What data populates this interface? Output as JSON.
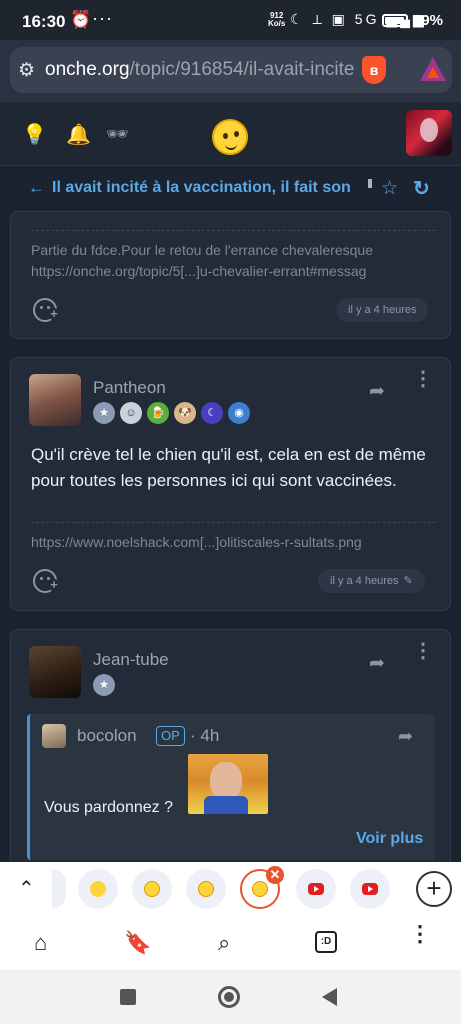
{
  "status_bar": {
    "time": "16:30",
    "alarm_icon": "⏰",
    "dots": "···",
    "net_speed_value": "912",
    "net_speed_unit": "Ko/s",
    "icons": "☾ ⟂ ▣ 5G ▂▄▆",
    "battery": "89%"
  },
  "browser": {
    "url_host": "onche.org",
    "url_path": "/topic/916854/il-avait-incite",
    "tune_icon": "⚙"
  },
  "site_header": {
    "bulb_icon": "💡",
    "bell_icon": "🔔",
    "spy_icon": "🕶"
  },
  "topic": {
    "back_icon": "←",
    "title": "Il avait incité à la vaccination, il fait son",
    "star_icon": "☆",
    "refresh_icon": "↻"
  },
  "posts": [
    {
      "signature_lines": [
        "Partie du fdce.Pour le retou de l'errance chevaleresque",
        "https://onche.org/topic/5[...]u-chevalier-errant#messag"
      ],
      "time": "il y a 4 heures"
    },
    {
      "author": "Pantheon",
      "badges": [
        "★",
        "☺",
        "🍺",
        "🐶",
        "☾",
        "◉"
      ],
      "body": "Qu'il crève tel le chien qu'il est, cela en est de même pour toutes les personnes ici qui sont vaccinées.",
      "signature_lines": [
        "https://www.noelshack.com[...]olitiscales-r-sultats.png"
      ],
      "time": "il y a 4 heures",
      "edit_icon": "✎"
    },
    {
      "author": "Jean-tube",
      "badges": [
        "★"
      ],
      "quote": {
        "author": "bocolon",
        "op_label": "OP",
        "time": "· 4h",
        "body": "Vous pardonnez ?",
        "more_label": "Voir plus"
      }
    }
  ],
  "icons": {
    "share": "➦",
    "more": "⋮",
    "up": "⌃",
    "close": "✕",
    "add": "+"
  },
  "tab_strip": {
    "tabs": [
      "yellow-dot",
      "onche",
      "onche",
      "onche-active",
      "youtube",
      "youtube"
    ]
  },
  "bottom_nav": {
    "home_icon": "⌂",
    "bookmark_icon": "🔖",
    "search_icon": "⌕",
    "tabs_label": ":D",
    "menu_icon": "⋮"
  },
  "colors": {
    "accent": "#5aa9e6",
    "background": "#1b2330",
    "card": "#222b37",
    "active_tab_ring": "#e8542c"
  }
}
